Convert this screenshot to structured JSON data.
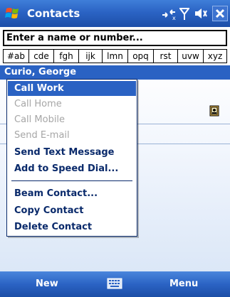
{
  "titlebar": {
    "title": "Contacts",
    "icons": [
      "windows-flag-icon",
      "connectivity-icon",
      "signal-icon",
      "volume-icon",
      "close-icon"
    ],
    "close_label": "✕"
  },
  "search": {
    "value": "Enter a name or number..."
  },
  "alpha_tabs": [
    "#ab",
    "cde",
    "fgh",
    "ijk",
    "lmn",
    "opq",
    "rst",
    "uvw",
    "xyz"
  ],
  "contact": {
    "name": "Curio, George"
  },
  "menu": {
    "items": [
      {
        "label": "Call Work",
        "state": "selected"
      },
      {
        "label": "Call Home",
        "state": "disabled"
      },
      {
        "label": "Call Mobile",
        "state": "disabled"
      },
      {
        "label": "Send E-mail",
        "state": "disabled"
      },
      {
        "label": "Send Text Message",
        "state": "enabled"
      },
      {
        "label": "Add to Speed Dial...",
        "state": "enabled"
      },
      {
        "label": "Beam Contact...",
        "state": "enabled"
      },
      {
        "label": "Copy Contact",
        "state": "enabled"
      },
      {
        "label": "Delete Contact",
        "state": "enabled"
      }
    ]
  },
  "softkeys": {
    "left": "New",
    "right": "Menu"
  },
  "colors": {
    "titlebar": "#2b63c4",
    "selection": "#2a62c3",
    "menu_text": "#0a2a6b",
    "disabled_text": "#a6a6a6"
  }
}
